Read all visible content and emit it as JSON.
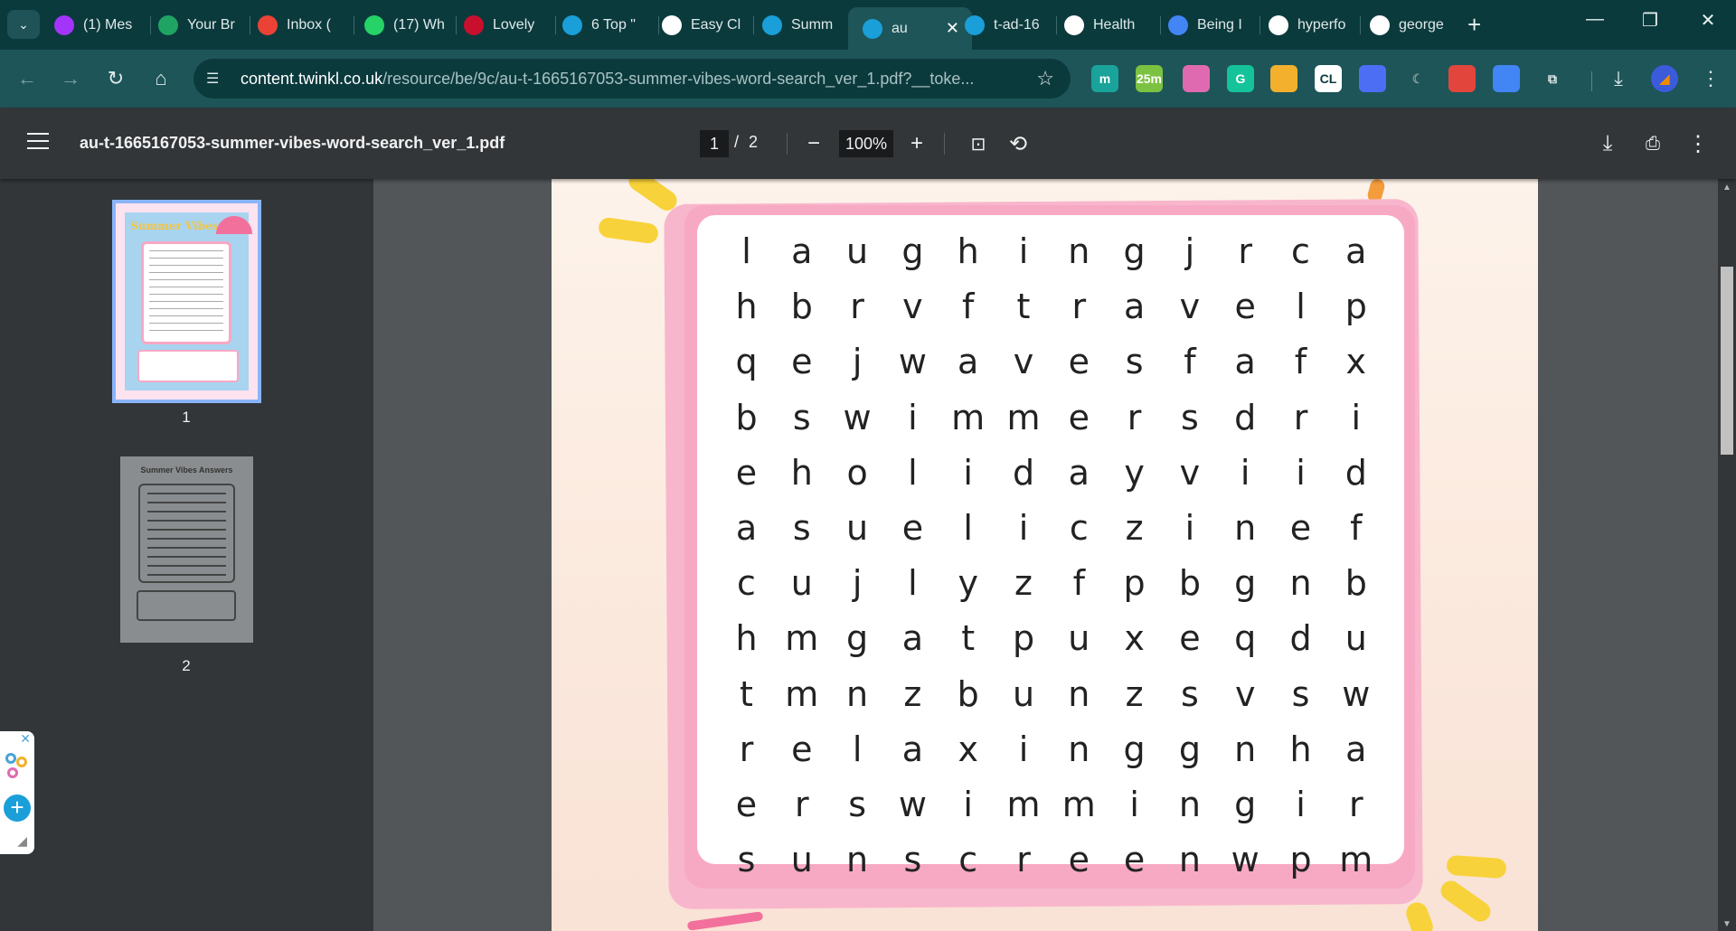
{
  "tabs": [
    {
      "title": "(1) Mes",
      "icon": "messenger-icon",
      "color": "#a334fa"
    },
    {
      "title": "Your Br",
      "icon": "google-drive-icon",
      "color": "#1fa463"
    },
    {
      "title": "Inbox (",
      "icon": "gmail-icon",
      "color": "#ea4335"
    },
    {
      "title": "(17) Wh",
      "icon": "whatsapp-icon",
      "color": "#25d366"
    },
    {
      "title": "Lovely",
      "icon": "car-icon",
      "color": "#c8102e"
    },
    {
      "title": "6 Top \"",
      "icon": "sailboat-icon",
      "color": "#1a9fd8"
    },
    {
      "title": "Easy Cl",
      "icon": "easy-logo-icon",
      "color": "#ffffff"
    },
    {
      "title": "Summ",
      "icon": "sailboat-icon",
      "color": "#1a9fd8"
    },
    {
      "title": "au",
      "icon": "twinkl-icon",
      "color": "#1a9fd8",
      "active": true
    },
    {
      "title": "t-ad-16",
      "icon": "twinkl-icon",
      "color": "#1a9fd8"
    },
    {
      "title": "Health",
      "icon": "health-icon",
      "color": "#ffffff"
    },
    {
      "title": "Being I",
      "icon": "google-docs-icon",
      "color": "#4285f4"
    },
    {
      "title": "hyperfo",
      "icon": "google-icon",
      "color": "#ffffff"
    },
    {
      "title": "george",
      "icon": "google-icon",
      "color": "#ffffff"
    }
  ],
  "omnibox": {
    "host": "content.twinkl.co.uk",
    "path": "/resource/be/9c/au-t-1665167053-summer-vibes-word-search_ver_1.pdf?__toke..."
  },
  "extensions": [
    {
      "name": "m-extension-icon",
      "label": "m",
      "color": "#1aa39a"
    },
    {
      "name": "timer-extension-icon",
      "label": "25m",
      "color": "#7cc242"
    },
    {
      "name": "paint-extension-icon",
      "label": "",
      "color": "#e06ab0"
    },
    {
      "name": "grammarly-icon",
      "label": "G",
      "color": "#15c39a"
    },
    {
      "name": "photos-extension-icon",
      "label": "",
      "color": "#f2b02c"
    },
    {
      "name": "cl-extension-icon",
      "label": "CL",
      "color": "#ffffff"
    },
    {
      "name": "sparkle-extension-icon",
      "label": "",
      "color": "#4c6ef5"
    },
    {
      "name": "dark-mode-icon",
      "label": "",
      "color": "#555555"
    },
    {
      "name": "pdf-extension-icon",
      "label": "",
      "color": "#e2453c"
    },
    {
      "name": "translate-icon",
      "label": "",
      "color": "#4285f4"
    },
    {
      "name": "extensions-puzzle-icon",
      "label": "",
      "color": "#dfe9e9"
    }
  ],
  "pdf": {
    "filename": "au-t-1665167053-summer-vibes-word-search_ver_1.pdf",
    "current_page": "1",
    "page_sep": "/",
    "total_pages": "2",
    "zoom": "100%"
  },
  "thumbnails": [
    {
      "label": "1",
      "title": "Summer Vibes"
    },
    {
      "label": "2",
      "title": "Summer Vibes Answers"
    }
  ],
  "wordsearch": [
    [
      "l",
      "a",
      "u",
      "g",
      "h",
      "i",
      "n",
      "g",
      "j",
      "r",
      "c",
      "a"
    ],
    [
      "h",
      "b",
      "r",
      "v",
      "f",
      "t",
      "r",
      "a",
      "v",
      "e",
      "l",
      "p"
    ],
    [
      "q",
      "e",
      "j",
      "w",
      "a",
      "v",
      "e",
      "s",
      "f",
      "a",
      "f",
      "x"
    ],
    [
      "b",
      "s",
      "w",
      "i",
      "m",
      "m",
      "e",
      "r",
      "s",
      "d",
      "r",
      "i"
    ],
    [
      "e",
      "h",
      "o",
      "l",
      "i",
      "d",
      "a",
      "y",
      "v",
      "i",
      "i",
      "d"
    ],
    [
      "a",
      "s",
      "u",
      "e",
      "l",
      "i",
      "c",
      "z",
      "i",
      "n",
      "e",
      "f"
    ],
    [
      "c",
      "u",
      "j",
      "l",
      "y",
      "z",
      "f",
      "p",
      "b",
      "g",
      "n",
      "b"
    ],
    [
      "h",
      "m",
      "g",
      "a",
      "t",
      "p",
      "u",
      "x",
      "e",
      "q",
      "d",
      "u"
    ],
    [
      "t",
      "m",
      "n",
      "z",
      "b",
      "u",
      "n",
      "z",
      "s",
      "v",
      "s",
      "w"
    ],
    [
      "r",
      "e",
      "l",
      "a",
      "x",
      "i",
      "n",
      "g",
      "g",
      "n",
      "h",
      "a"
    ],
    [
      "e",
      "r",
      "s",
      "w",
      "i",
      "m",
      "m",
      "i",
      "n",
      "g",
      "i",
      "r"
    ],
    [
      "s",
      "u",
      "n",
      "s",
      "c",
      "r",
      "e",
      "e",
      "n",
      "w",
      "p",
      "m"
    ]
  ],
  "colors": {
    "tabstrip": "#0b3a3d",
    "toolbar": "#1e5559",
    "pdf_toolbar": "#323639",
    "frame_pink": "#f7a9c3",
    "splash_yellow": "#f8d23a"
  }
}
